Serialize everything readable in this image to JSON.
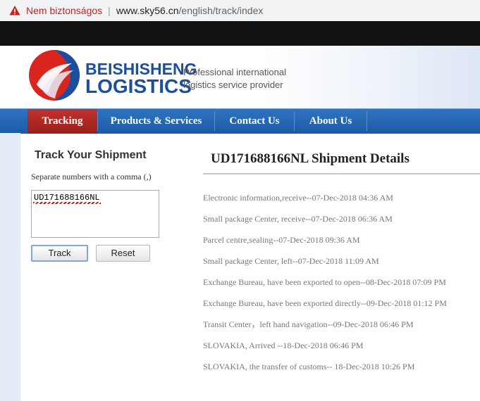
{
  "browser": {
    "security_label": "Nem biztonságos",
    "url_host": "www.sky56.cn",
    "url_path": "/english/track/index"
  },
  "header": {
    "brand_line1": "BEISHISHENG",
    "brand_line2": "LOGISTICS",
    "tagline_line1": "Professional international",
    "tagline_line2": "logistics service provider"
  },
  "nav": {
    "items": [
      {
        "label": "Tracking",
        "active": true
      },
      {
        "label": "Products & Services",
        "active": false
      },
      {
        "label": "Contact Us",
        "active": false
      },
      {
        "label": "About Us",
        "active": false
      }
    ]
  },
  "track": {
    "title": "Track Your Shipment",
    "hint": "Separate numbers with a comma (,)",
    "input_value": "UD171688166NL",
    "track_label": "Track",
    "reset_label": "Reset"
  },
  "details": {
    "title": "UD171688166NL Shipment Details",
    "events": [
      "Electronic information,receive--07-Dec-2018 04:36 AM",
      "Small package Center, receive--07-Dec-2018 06:36 AM",
      "Parcel centre,sealing--07-Dec-2018 09:36 AM",
      "Small package Center, left--07-Dec-2018 11:09 AM",
      "Exchange Bureau, have been exported to open--08-Dec-2018 07:09 PM",
      "Exchange Bureau, have been exported directly--09-Dec-2018 01:12 PM",
      "Transit Center，left hand navigation--09-Dec-2018 06:46 PM",
      "SLOVAKIA, Arrived --18-Dec-2018 06:46 PM",
      "SLOVAKIA, the transfer of customs-- 18-Dec-2018 10:26 PM"
    ]
  },
  "colors": {
    "brand_blue": "#1c4ea0",
    "nav_blue": "#1b5aa5",
    "nav_active_red": "#b02a25",
    "logo_red": "#d9251d"
  }
}
